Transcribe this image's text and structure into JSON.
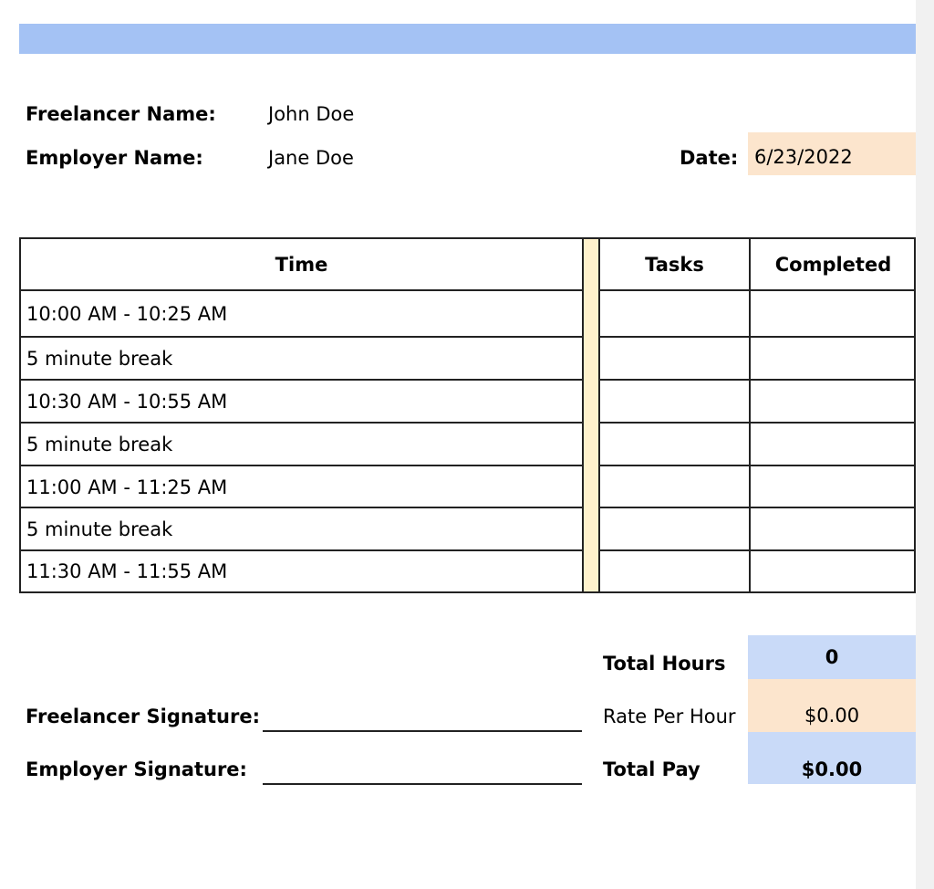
{
  "header": {
    "freelancer_label": "Freelancer Name:",
    "freelancer_value": "John Doe",
    "employer_label": "Employer Name:",
    "employer_value": "Jane Doe",
    "date_label": "Date:",
    "date_value": "6/23/2022"
  },
  "table": {
    "columns": [
      "Time",
      "Tasks",
      "Completed"
    ],
    "rows": [
      {
        "time": "10:00 AM - 10:25 AM",
        "tasks": "",
        "completed": ""
      },
      {
        "time": "5 minute break",
        "tasks": "",
        "completed": ""
      },
      {
        "time": "10:30 AM - 10:55 AM",
        "tasks": "",
        "completed": ""
      },
      {
        "time": "5 minute break",
        "tasks": "",
        "completed": ""
      },
      {
        "time": "11:00 AM - 11:25 AM",
        "tasks": "",
        "completed": ""
      },
      {
        "time": "5 minute break",
        "tasks": "",
        "completed": ""
      },
      {
        "time": "11:30 AM - 11:55 AM",
        "tasks": "",
        "completed": ""
      }
    ]
  },
  "summary": {
    "total_hours_label": "Total Hours",
    "total_hours_value": "0",
    "rate_label": "Rate Per Hour",
    "rate_value": "$0.00",
    "total_pay_label": "Total Pay",
    "total_pay_value": "$0.00"
  },
  "signatures": {
    "freelancer_label": "Freelancer Signature:",
    "employer_label": "Employer Signature:"
  },
  "colors": {
    "band_blue": "#a4c2f4",
    "light_blue": "#c9daf8",
    "peach": "#fce5cd",
    "spacer_yellow": "#fff2cc"
  }
}
